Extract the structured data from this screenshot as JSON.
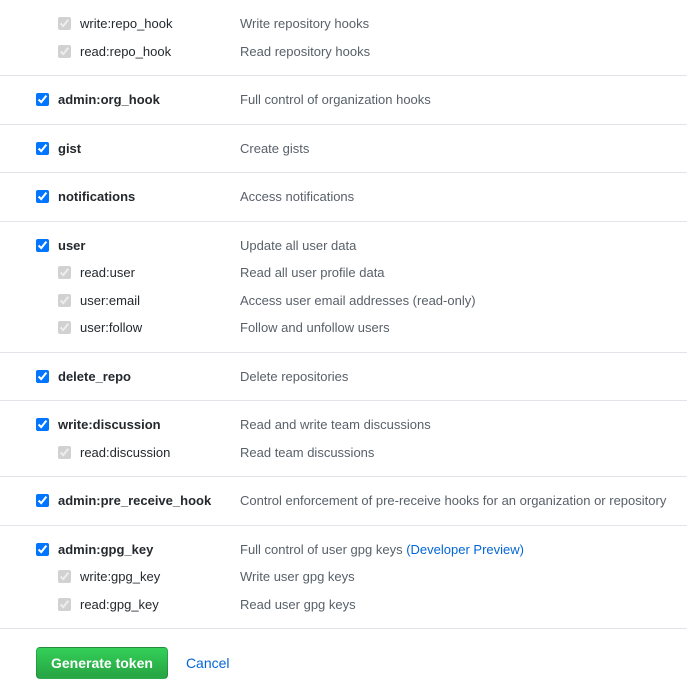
{
  "scopes": {
    "repo_hook": {
      "write": {
        "name": "write:repo_hook",
        "desc": "Write repository hooks",
        "checked": true,
        "disabled": true
      },
      "read": {
        "name": "read:repo_hook",
        "desc": "Read repository hooks",
        "checked": true,
        "disabled": true
      }
    },
    "org_hook": {
      "parent": {
        "name": "admin:org_hook",
        "desc": "Full control of organization hooks",
        "checked": true
      }
    },
    "gist": {
      "parent": {
        "name": "gist",
        "desc": "Create gists",
        "checked": true
      }
    },
    "notifications": {
      "parent": {
        "name": "notifications",
        "desc": "Access notifications",
        "checked": true
      }
    },
    "user": {
      "parent": {
        "name": "user",
        "desc": "Update all user data",
        "checked": true
      },
      "read": {
        "name": "read:user",
        "desc": "Read all user profile data",
        "checked": true,
        "disabled": true
      },
      "email": {
        "name": "user:email",
        "desc": "Access user email addresses (read-only)",
        "checked": true,
        "disabled": true
      },
      "follow": {
        "name": "user:follow",
        "desc": "Follow and unfollow users",
        "checked": true,
        "disabled": true
      }
    },
    "delete_repo": {
      "parent": {
        "name": "delete_repo",
        "desc": "Delete repositories",
        "checked": true
      }
    },
    "discussion": {
      "parent": {
        "name": "write:discussion",
        "desc": "Read and write team discussions",
        "checked": true
      },
      "read": {
        "name": "read:discussion",
        "desc": "Read team discussions",
        "checked": true,
        "disabled": true
      }
    },
    "pre_receive_hook": {
      "parent": {
        "name": "admin:pre_receive_hook",
        "desc": "Control enforcement of pre-receive hooks for an organization or repository",
        "checked": true
      }
    },
    "gpg_key": {
      "parent": {
        "name": "admin:gpg_key",
        "desc": "Full control of user gpg keys ",
        "link": "(Developer Preview)",
        "checked": true
      },
      "write": {
        "name": "write:gpg_key",
        "desc": "Write user gpg keys",
        "checked": true,
        "disabled": true
      },
      "read": {
        "name": "read:gpg_key",
        "desc": "Read user gpg keys",
        "checked": true,
        "disabled": true
      }
    }
  },
  "actions": {
    "generate": "Generate token",
    "cancel": "Cancel"
  }
}
